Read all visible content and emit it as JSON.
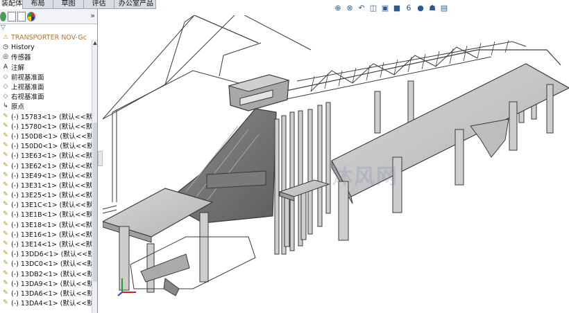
{
  "tabs": [
    {
      "label": "装配体",
      "active": true
    },
    {
      "label": "布局",
      "active": false
    },
    {
      "label": "草图",
      "active": false
    },
    {
      "label": "评估",
      "active": false
    },
    {
      "label": "办公室产品",
      "active": false
    }
  ],
  "feature_manager": {
    "more_label": "»",
    "filter_label": "▽",
    "tree": [
      {
        "icon": "assembly-warning-icon",
        "label": "TRANSPORTER NOV-Gc",
        "kind": "root"
      },
      {
        "icon": "history-icon",
        "label": "History",
        "kind": "folder"
      },
      {
        "icon": "sensor-icon",
        "label": "传感器",
        "kind": "folder"
      },
      {
        "icon": "annotation-icon",
        "label": "注解",
        "kind": "folder"
      },
      {
        "icon": "plane-icon",
        "label": "前视基准面",
        "kind": "plane"
      },
      {
        "icon": "plane-icon",
        "label": "上视基准面",
        "kind": "plane"
      },
      {
        "icon": "plane-icon",
        "label": "右视基准面",
        "kind": "plane"
      },
      {
        "icon": "origin-icon",
        "label": "原点",
        "kind": "origin"
      },
      {
        "icon": "part-icon",
        "label": "(-) 15783<1> (默认<<默",
        "kind": "part"
      },
      {
        "icon": "part-icon",
        "label": "(-) 15780<1> (默认<<默",
        "kind": "part"
      },
      {
        "icon": "part-icon",
        "label": "(-) 150D8<1> (默认<<默",
        "kind": "part"
      },
      {
        "icon": "part-icon",
        "label": "(-) 150D0<1> (默认<<默",
        "kind": "part"
      },
      {
        "icon": "part-icon",
        "label": "(-) 13E63<1> (默认<<默",
        "kind": "part"
      },
      {
        "icon": "part-icon",
        "label": "(-) 13E62<1> (默认<<默",
        "kind": "part"
      },
      {
        "icon": "part-icon",
        "label": "(-) 13E49<1> (默认<<默",
        "kind": "part"
      },
      {
        "icon": "part-icon",
        "label": "(-) 13E31<1> (默认<<默",
        "kind": "part"
      },
      {
        "icon": "part-icon",
        "label": "(-) 13E25<1> (默认<<默",
        "kind": "part"
      },
      {
        "icon": "part-icon",
        "label": "(-) 13E1C<1> (默认<<默",
        "kind": "part"
      },
      {
        "icon": "part-icon",
        "label": "(-) 13E1B<1> (默认<<默",
        "kind": "part"
      },
      {
        "icon": "part-icon",
        "label": "(-) 13E18<1> (默认<<默",
        "kind": "part"
      },
      {
        "icon": "part-icon",
        "label": "(-) 13E16<1> (默认<<默",
        "kind": "part"
      },
      {
        "icon": "part-icon",
        "label": "(-) 13E14<1> (默认<<默",
        "kind": "part"
      },
      {
        "icon": "part-icon",
        "label": "(-) 13DD6<1> (默认<<默",
        "kind": "part"
      },
      {
        "icon": "part-icon",
        "label": "(-) 13DC0<1> (默认<<默",
        "kind": "part"
      },
      {
        "icon": "part-icon",
        "label": "(-) 13DB2<1> (默认<<默",
        "kind": "part"
      },
      {
        "icon": "part-icon",
        "label": "(-) 13DA9<1> (默认<<默",
        "kind": "part"
      },
      {
        "icon": "part-icon",
        "label": "(-) 13DA6<1> (默认<<默",
        "kind": "part"
      },
      {
        "icon": "part-icon",
        "label": "(-) 13DA4<1> (默认<<默",
        "kind": "part"
      }
    ]
  },
  "hud_icons": [
    "zoom-to-fit-icon",
    "zoom-area-icon",
    "previous-view-icon",
    "section-view-icon",
    "view-orientation-icon",
    "display-style-icon",
    "hide-show-icon",
    "edit-appearance-icon",
    "apply-scene-icon",
    "view-settings-icon"
  ],
  "watermark": "沐风网",
  "colors": {
    "model_fill": "#c9c9c9",
    "model_edge": "#3a3a3a",
    "tab_bar": "#d9dde3"
  }
}
